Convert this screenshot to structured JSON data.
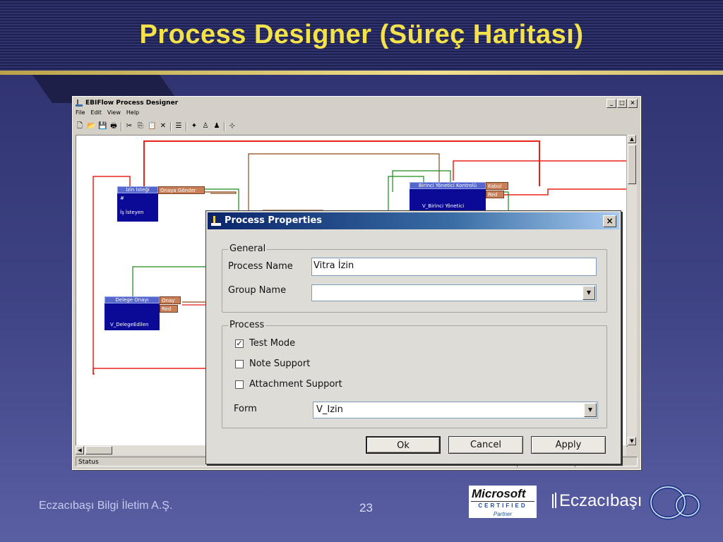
{
  "slide": {
    "title": "Process Designer (Süreç Haritası)",
    "footer_company": "Eczacıbaşı Bilgi İletim A.Ş.",
    "page_number": "23"
  },
  "app": {
    "title": "EBIFlow Process Designer",
    "menus": [
      "File",
      "Edit",
      "View",
      "Help"
    ],
    "status": "Status",
    "nodes": [
      {
        "name": "İzin İsteği",
        "extra": "#",
        "role": "İş İsteyen",
        "ports": [
          "Onaya Gönder"
        ]
      },
      {
        "name": "Birinci Yönetici Kontrolü",
        "role": "V_Birinci Yönetici",
        "ports": [
          "Kabul",
          "Red"
        ]
      },
      {
        "name": "Delege Onayı",
        "role": "V_DelegeEdilen",
        "ports": [
          "Onay",
          "Red"
        ]
      }
    ],
    "colors": {
      "red_link": "#e8221a",
      "green_link": "#1a8a1a",
      "brown_link": "#8a4b16",
      "node": "#0a0a96"
    }
  },
  "dialog": {
    "title": "Process Properties",
    "general_group": "General",
    "process_name_label": "Process Name",
    "process_name_value": "Vitra İzin",
    "group_name_label": "Group Name",
    "group_name_value": "",
    "process_group": "Process",
    "test_mode_label": "Test Mode",
    "test_mode_checked": true,
    "note_support_label": "Note Support",
    "note_support_checked": false,
    "attachment_support_label": "Attachment Support",
    "attachment_support_checked": false,
    "form_label": "Form",
    "form_value": "V_Izin",
    "ok_label": "Ok",
    "cancel_label": "Cancel",
    "apply_label": "Apply",
    "close_glyph": "×"
  },
  "logos": {
    "ms_line1": "Microsoft",
    "ms_line2": "CERTIFIED",
    "ms_line3": "Partner",
    "brand": "Eczacıbaşı"
  }
}
